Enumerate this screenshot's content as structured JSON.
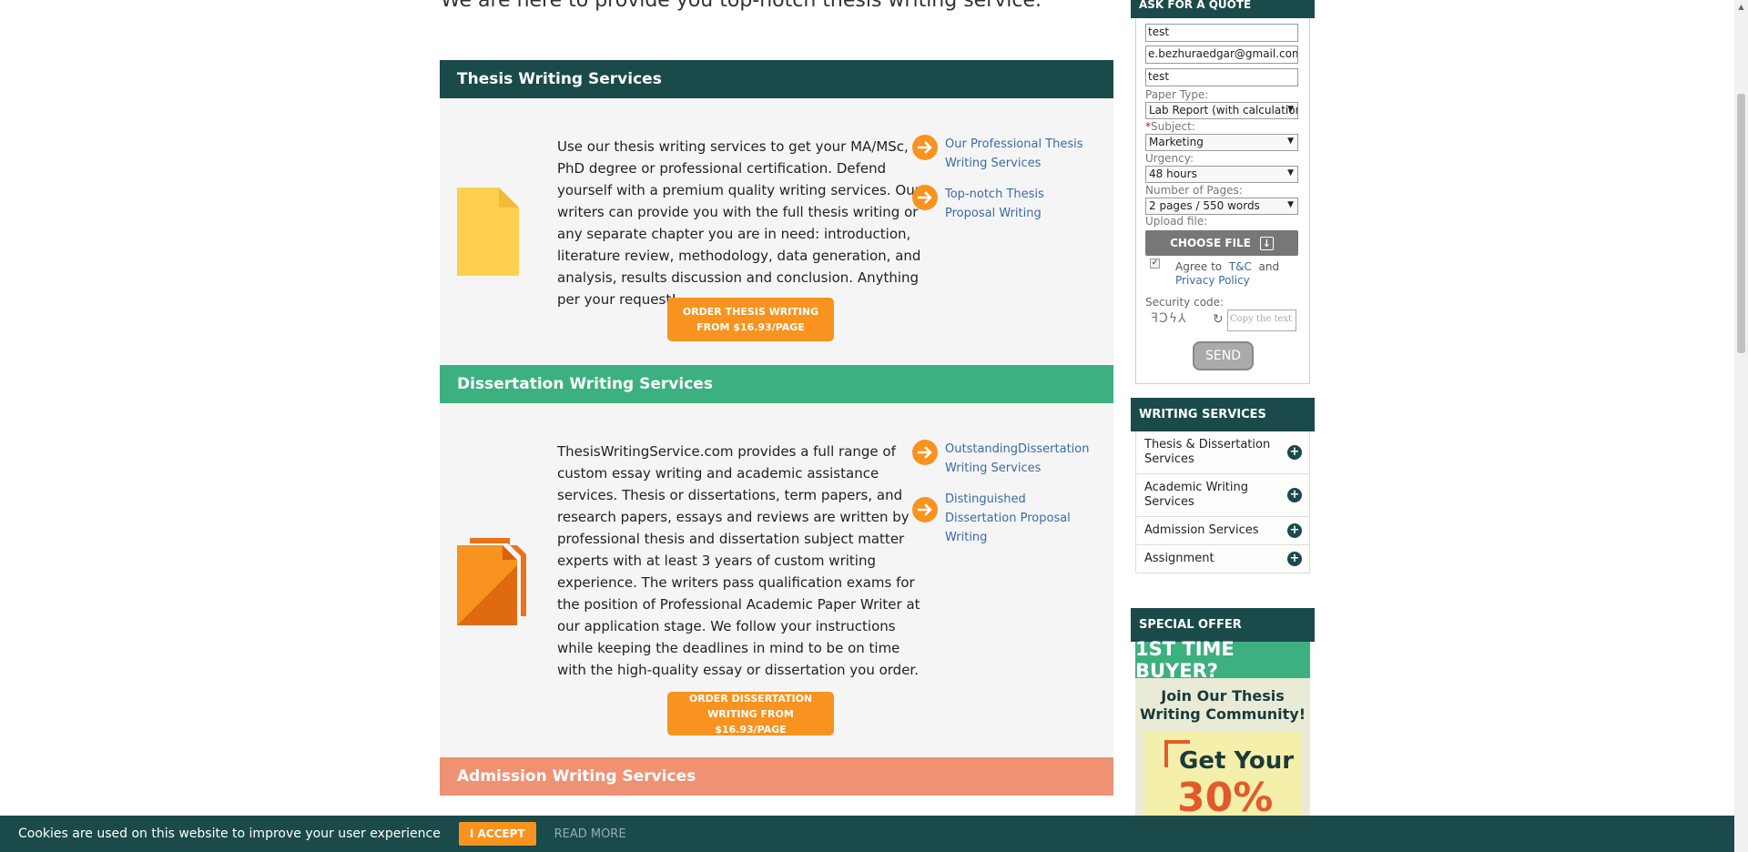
{
  "intro_line": "We are here to provide you top-notch thesis writing service.",
  "sections": [
    {
      "title": "Thesis Writing Services",
      "color": "#1b4a4a",
      "text": "Use our thesis writing services to get your MA/MSc, PhD degree or professional certification. Defend yourself with a premium quality writing services. Our writers can provide you with the full thesis writing or any separate chapter you are in need: introduction, literature review, methodology, data generation, and analysis, results discussion and conclusion. Anything per your request!",
      "links": [
        "Our Professional Thesis Writing Services",
        "Top-notch Thesis Proposal Writing"
      ],
      "button": "ORDER THESIS WRITING FROM $16.93/PAGE"
    },
    {
      "title": "Dissertation Writing Services",
      "color": "#3db080",
      "text": "ThesisWritingService.com provides a full range of custom essay writing and academic assistance services. Thesis or dissertations, term papers, and research papers, essays and reviews are written by professional thesis and dissertation subject matter experts with at least 3 years of custom writing experience. The writers pass qualification exams for the position of Professional Academic Paper Writer at our application stage. We follow your instructions while keeping the deadlines in mind to be on time with the high-quality essay or dissertation you order.",
      "links": [
        "OutstandingDissertation Writing Services",
        "Distinguished Dissertation Proposal Writing"
      ],
      "button": "ORDER DISSERTATION WRITING FROM $16.93/PAGE"
    },
    {
      "title": "Admission Writing Services",
      "color": "#ef9274"
    }
  ],
  "quote": {
    "heading": "ASK FOR A QUOTE",
    "name_value": "test",
    "email_value": "e.bezhuraedgar@gmail.com",
    "phone_value": "test",
    "paper_type_label": "Paper Type:",
    "paper_type_value": "Lab Report (with calculations)",
    "subject_required_mark": "*",
    "subject_label": "Subject:",
    "subject_value": "Marketing",
    "urgency_label": "Urgency:",
    "urgency_value": "48 hours",
    "pages_label": "Number of Pages:",
    "pages_value": "2 pages / 550 words",
    "upload_label": "Upload file:",
    "choose_file": "CHOOSE FILE",
    "agree_prefix": "Agree to",
    "tc_link": "T&C",
    "agree_and": "and",
    "privacy_link": "Privacy Policy",
    "security_label": "Security code:",
    "captcha_text": "ꟻƆϟ⅄",
    "code_placeholder": "Copy the text",
    "send": "SEND"
  },
  "writing_services": {
    "heading": "WRITING SERVICES",
    "items": [
      "Thesis & Dissertation Services",
      "Academic Writing Services",
      "Admission Services",
      "Assignment"
    ]
  },
  "special_offer": {
    "heading": "SPECIAL OFFER",
    "band": "1ST TIME BUYER?",
    "join": "Join Our Thesis Writing Community!",
    "get_your": "Get Your",
    "percent": "30%"
  },
  "cookie": {
    "text": "Cookies are used on this website to improve your user experience",
    "accept": "I ACCEPT",
    "read_more": "READ MORE"
  }
}
